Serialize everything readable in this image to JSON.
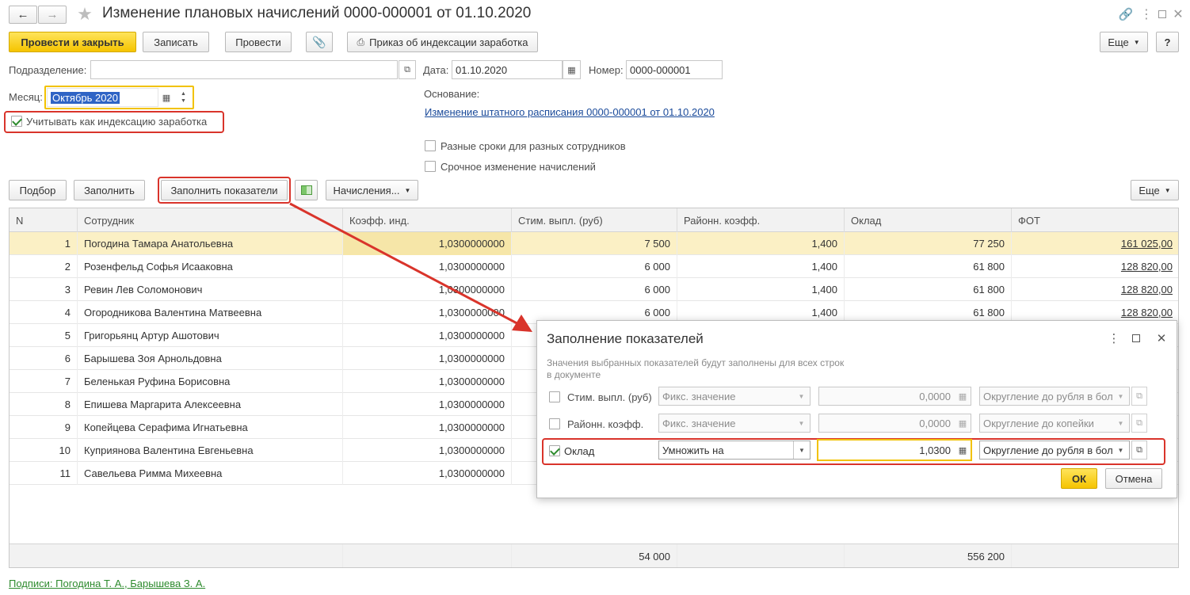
{
  "window": {
    "title": "Изменение плановых начислений 0000-000001 от 01.10.2020"
  },
  "toolbar": {
    "post_close": "Провести и закрыть",
    "save": "Записать",
    "post": "Провести",
    "print_order": "Приказ об индексации заработка",
    "more": "Еще"
  },
  "form": {
    "division_label": "Подразделение:",
    "division_value": "",
    "date_label": "Дата:",
    "date_value": "01.10.2020",
    "number_label": "Номер:",
    "number_value": "0000-000001",
    "month_label": "Месяц:",
    "month_value": "Октябрь 2020",
    "indexation_label": "Учитывать как индексацию заработка",
    "indexation_checked": true,
    "basis_label": "Основание:",
    "basis_link": "Изменение штатного расписания 0000-000001 от 01.10.2020",
    "diff_dates_label": "Разные сроки для разных сотрудников",
    "urgent_label": "Срочное изменение начислений"
  },
  "table_toolbar": {
    "pick": "Подбор",
    "fill": "Заполнить",
    "fill_indicators": "Заполнить показатели",
    "accruals": "Начисления...",
    "more": "Еще"
  },
  "table": {
    "columns": [
      "N",
      "Сотрудник",
      "Коэфф. инд.",
      "Стим. выпл. (руб)",
      "Районн. коэфф.",
      "Оклад",
      "ФОТ"
    ],
    "rows": [
      {
        "n": "1",
        "name": "Погодина Тамара Анатольевна",
        "coef": "1,0300000000",
        "stim": "7 500",
        "rk": "1,400",
        "salary": "77 250",
        "fot": "161 025,00"
      },
      {
        "n": "2",
        "name": "Розенфельд Софья Исааковна",
        "coef": "1,0300000000",
        "stim": "6 000",
        "rk": "1,400",
        "salary": "61 800",
        "fot": "128 820,00"
      },
      {
        "n": "3",
        "name": "Ревин Лев Соломонович",
        "coef": "1,0300000000",
        "stim": "6 000",
        "rk": "1,400",
        "salary": "61 800",
        "fot": "128 820,00"
      },
      {
        "n": "4",
        "name": "Огородникова Валентина Матвеевна",
        "coef": "1,0300000000",
        "stim": "6 000",
        "rk": "1,400",
        "salary": "61 800",
        "fot": "128 820,00"
      },
      {
        "n": "5",
        "name": "Григорьянц Артур Ашотович",
        "coef": "1,0300000000",
        "stim": "",
        "rk": "",
        "salary": "",
        "fot": ""
      },
      {
        "n": "6",
        "name": "Барышева Зоя Арнольдовна",
        "coef": "1,0300000000",
        "stim": "",
        "rk": "",
        "salary": "",
        "fot": ""
      },
      {
        "n": "7",
        "name": "Беленькая Руфина Борисовна",
        "coef": "1,0300000000",
        "stim": "",
        "rk": "",
        "salary": "",
        "fot": ""
      },
      {
        "n": "8",
        "name": "Епишева Маргарита Алексеевна",
        "coef": "1,0300000000",
        "stim": "",
        "rk": "",
        "salary": "",
        "fot": ""
      },
      {
        "n": "9",
        "name": "Копейцева Серафима Игнатьевна",
        "coef": "1,0300000000",
        "stim": "",
        "rk": "",
        "salary": "",
        "fot": ""
      },
      {
        "n": "10",
        "name": "Куприянова Валентина Евгеньевна",
        "coef": "1,0300000000",
        "stim": "",
        "rk": "",
        "salary": "",
        "fot": ""
      },
      {
        "n": "11",
        "name": "Савельева Римма Михеевна",
        "coef": "1,0300000000",
        "stim": "",
        "rk": "",
        "salary": "",
        "fot": ""
      }
    ],
    "totals": {
      "stim": "54 000",
      "salary": "556 200"
    }
  },
  "signatures": "Подписи: Погодина Т. А., Барышева З. А.",
  "dialog": {
    "title": "Заполнение показателей",
    "hint": "Значения выбранных показателей будут заполнены для всех строк в документе",
    "rows": [
      {
        "label": "Стим. выпл. (руб)",
        "checked": false,
        "mode": "Фикс. значение",
        "value": "0,0000",
        "rounding": "Округление до рубля в бол"
      },
      {
        "label": "Районн. коэфф.",
        "checked": false,
        "mode": "Фикс. значение",
        "value": "0,0000",
        "rounding": "Округление до копейки"
      },
      {
        "label": "Оклад",
        "checked": true,
        "mode": "Умножить на",
        "value": "1,0300",
        "rounding": "Округление до рубля в бол"
      }
    ],
    "ok": "ОК",
    "cancel": "Отмена"
  },
  "colors": {
    "accent_yellow": "#f5c400",
    "annotation_red": "#d9342b",
    "link_blue": "#1a4a9a",
    "link_green": "#2e8b2e",
    "selected_row": "#fbf0c5"
  }
}
